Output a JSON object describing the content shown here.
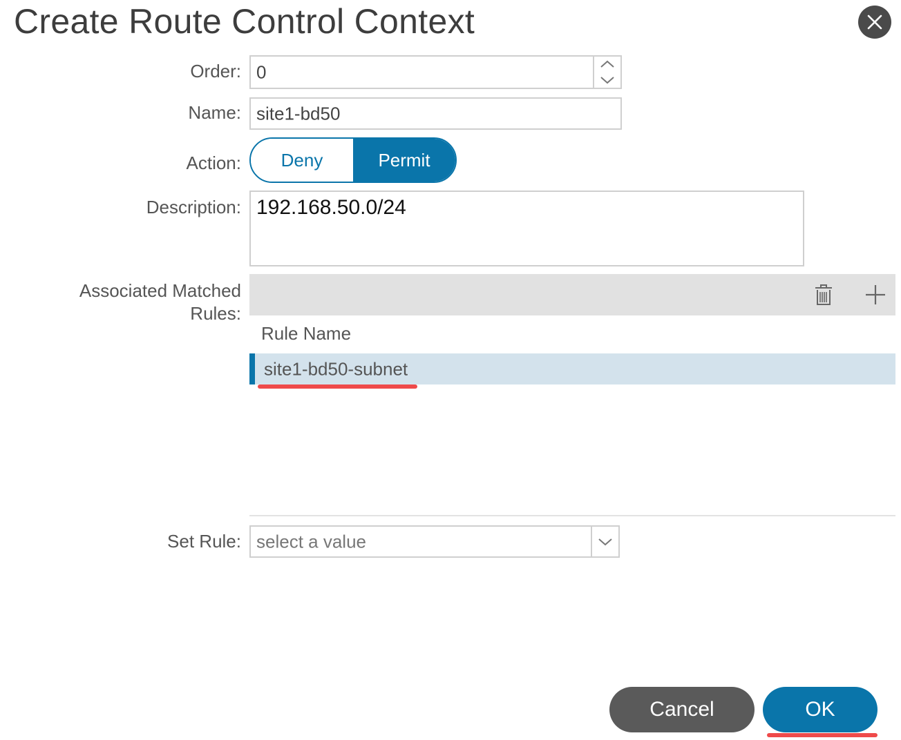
{
  "dialog": {
    "title": "Create Route Control Context",
    "close_icon": "close-icon"
  },
  "form": {
    "order": {
      "label": "Order:",
      "value": "0"
    },
    "name": {
      "label": "Name:",
      "value": "site1-bd50"
    },
    "action": {
      "label": "Action:",
      "options": [
        "Deny",
        "Permit"
      ],
      "selected": "Permit"
    },
    "description": {
      "label": "Description:",
      "value": "192.168.50.0/24"
    },
    "matched_rules": {
      "label_line1": "Associated Matched",
      "label_line2": "Rules:",
      "column_header": "Rule Name",
      "rows": [
        {
          "rule_name": "site1-bd50-subnet",
          "selected": true
        }
      ],
      "toolbar_icons": [
        "trash-icon",
        "plus-icon"
      ]
    },
    "set_rule": {
      "label": "Set Rule:",
      "placeholder": "select a value"
    }
  },
  "footer": {
    "cancel_label": "Cancel",
    "ok_label": "OK"
  },
  "colors": {
    "accent": "#0a75aa",
    "annotation": "#ef4a4a",
    "selected_row": "#d3e2ec",
    "cancel_button": "#5a5a5a"
  }
}
